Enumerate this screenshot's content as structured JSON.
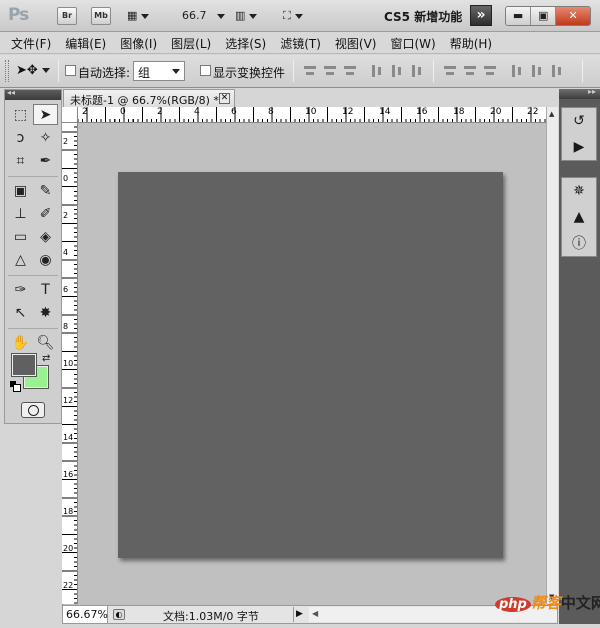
{
  "app": {
    "logo": "Ps",
    "bridge_button": "Br",
    "minibridge_button": "Mb",
    "zoom_value": "66.7",
    "workspace": "CS5 新增功能",
    "window_controls": {
      "minimize": "▬",
      "maximize": "▣",
      "close": "✕"
    }
  },
  "menu": [
    "文件(F)",
    "编辑(E)",
    "图像(I)",
    "图层(L)",
    "选择(S)",
    "滤镜(T)",
    "视图(V)",
    "窗口(W)",
    "帮助(H)"
  ],
  "options_bar": {
    "auto_select_label": "自动选择:",
    "auto_select_value": "组",
    "show_transform_label": "显示变换控件"
  },
  "tools": [
    [
      "marquee-tool",
      "move-tool"
    ],
    [
      "lasso-tool",
      "magic-wand-tool"
    ],
    [
      "crop-tool",
      "eyedropper-tool"
    ],
    [
      "healing-brush-tool",
      "brush-tool"
    ],
    [
      "clone-stamp-tool",
      "history-brush-tool"
    ],
    [
      "eraser-tool",
      "paint-bucket-tool"
    ],
    [
      "blur-tool",
      "dodge-tool"
    ],
    [
      "pen-tool",
      "type-tool"
    ],
    [
      "path-selection-tool",
      "custom-shape-tool"
    ],
    [
      "hand-tool",
      "zoom-tool"
    ]
  ],
  "colors": {
    "foreground": "#606060",
    "background": "#99f28f",
    "canvas": "#636262",
    "pasteboard": "#c0c0c0"
  },
  "document": {
    "tab_title": "未标题-1 @ 66.7%(RGB/8) *",
    "ruler_h_labels": [
      "2",
      "0",
      "2",
      "4",
      "6",
      "8",
      "10",
      "12",
      "14",
      "16",
      "18",
      "20",
      "22"
    ],
    "ruler_v_labels": [
      "2",
      "0",
      "2",
      "4",
      "6",
      "8",
      "10",
      "12",
      "14",
      "16",
      "18",
      "20",
      "22"
    ]
  },
  "status": {
    "zoom": "66.67%",
    "doc_info": "文档:1.03M/0 字节"
  },
  "right_panel": {
    "group1": [
      "history-icon",
      "actions-icon"
    ],
    "group2": [
      "navigator-icon",
      "histogram-icon",
      "info-icon"
    ]
  },
  "watermark": {
    "badge": "php",
    "text_orange": "帮客",
    "text": "中文网"
  }
}
